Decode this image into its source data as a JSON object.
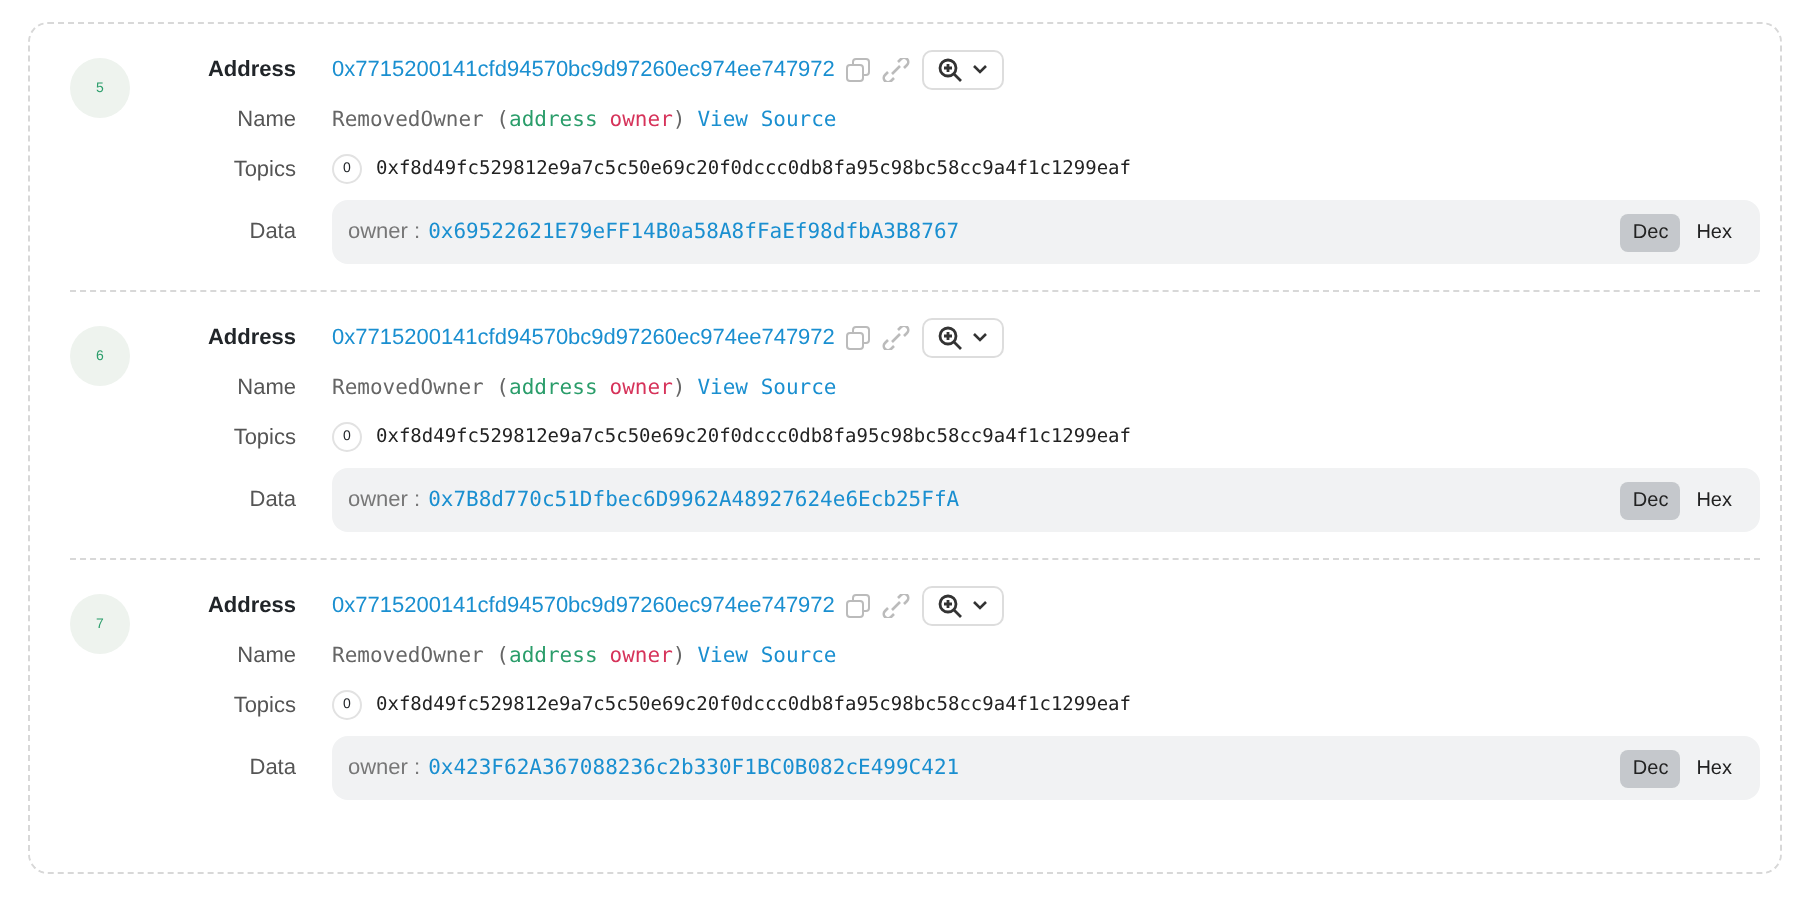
{
  "logs": [
    {
      "index": "5",
      "address_label": "Address",
      "address": "0x7715200141cfd94570bc9d97260ec974ee747972",
      "name_label": "Name",
      "event": "RemovedOwner",
      "open_paren": "(",
      "param_type": "address",
      "param_name": "owner",
      "close_paren": ")",
      "view_source": "View Source",
      "topics_label": "Topics",
      "topics": [
        {
          "index": "0",
          "value": "0xf8d49fc529812e9a7c5c50e69c20f0dccc0db8fa95c98bc58cc9a4f1c1299eaf"
        }
      ],
      "data_label": "Data",
      "data_key": "owner",
      "data_sep": ":",
      "data_value": "0x69522621E79eFF14B0a58A8fFaEf98dfbA3B8767",
      "formats": [
        {
          "label": "Dec",
          "selected": true
        },
        {
          "label": "Hex",
          "selected": false
        }
      ]
    },
    {
      "index": "6",
      "address_label": "Address",
      "address": "0x7715200141cfd94570bc9d97260ec974ee747972",
      "name_label": "Name",
      "event": "RemovedOwner",
      "open_paren": "(",
      "param_type": "address",
      "param_name": "owner",
      "close_paren": ")",
      "view_source": "View Source",
      "topics_label": "Topics",
      "topics": [
        {
          "index": "0",
          "value": "0xf8d49fc529812e9a7c5c50e69c20f0dccc0db8fa95c98bc58cc9a4f1c1299eaf"
        }
      ],
      "data_label": "Data",
      "data_key": "owner",
      "data_sep": ":",
      "data_value": "0x7B8d770c51Dfbec6D9962A48927624e6Ecb25FfA",
      "formats": [
        {
          "label": "Dec",
          "selected": true
        },
        {
          "label": "Hex",
          "selected": false
        }
      ]
    },
    {
      "index": "7",
      "address_label": "Address",
      "address": "0x7715200141cfd94570bc9d97260ec974ee747972",
      "name_label": "Name",
      "event": "RemovedOwner",
      "open_paren": "(",
      "param_type": "address",
      "param_name": "owner",
      "close_paren": ")",
      "view_source": "View Source",
      "topics_label": "Topics",
      "topics": [
        {
          "index": "0",
          "value": "0xf8d49fc529812e9a7c5c50e69c20f0dccc0db8fa95c98bc58cc9a4f1c1299eaf"
        }
      ],
      "data_label": "Data",
      "data_key": "owner",
      "data_sep": ":",
      "data_value": "0x423F62A367088236c2b330F1BC0B082cE499C421",
      "formats": [
        {
          "label": "Dec",
          "selected": true
        },
        {
          "label": "Hex",
          "selected": false
        }
      ]
    }
  ]
}
